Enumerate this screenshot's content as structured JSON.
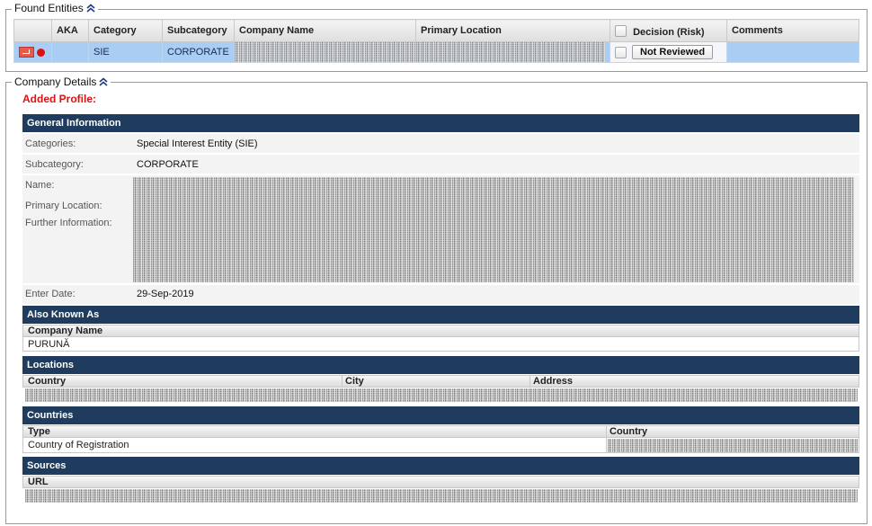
{
  "found_entities": {
    "legend": "Found Entities",
    "columns": [
      "",
      "AKA",
      "Category",
      "Subcategory",
      "Company Name",
      "Primary Location",
      "Decision (Risk)",
      "Comments"
    ],
    "row": {
      "aka": "",
      "category": "SIE",
      "subcategory": "CORPORATE",
      "company_name": "",
      "primary_location": "",
      "decision_button": "Not Reviewed",
      "comments": ""
    }
  },
  "company_details": {
    "legend": "Company Details",
    "added_profile": "Added Profile:",
    "general_information": {
      "title": "General Information",
      "labels": {
        "categories": "Categories:",
        "subcategory": "Subcategory:",
        "name": "Name:",
        "primary_location": "Primary Location:",
        "further_information": "Further Information:",
        "enter_date": "Enter Date:"
      },
      "values": {
        "categories": "Special Interest Entity (SIE)",
        "subcategory": "CORPORATE",
        "enter_date": "29-Sep-2019"
      }
    },
    "also_known_as": {
      "title": "Also Known As",
      "column": "Company Name",
      "rows": [
        "PURUNĂ"
      ]
    },
    "locations": {
      "title": "Locations",
      "columns": [
        "Country",
        "City",
        "Address"
      ]
    },
    "countries": {
      "title": "Countries",
      "columns": [
        "Type",
        "Country"
      ],
      "rows": [
        {
          "type": "Country of Registration"
        }
      ]
    },
    "sources": {
      "title": "Sources",
      "column": "URL"
    }
  },
  "colors": {
    "section_bar": "#1f3c5e",
    "selected_row": "#a9cdf3",
    "added_profile": "#e01010"
  }
}
